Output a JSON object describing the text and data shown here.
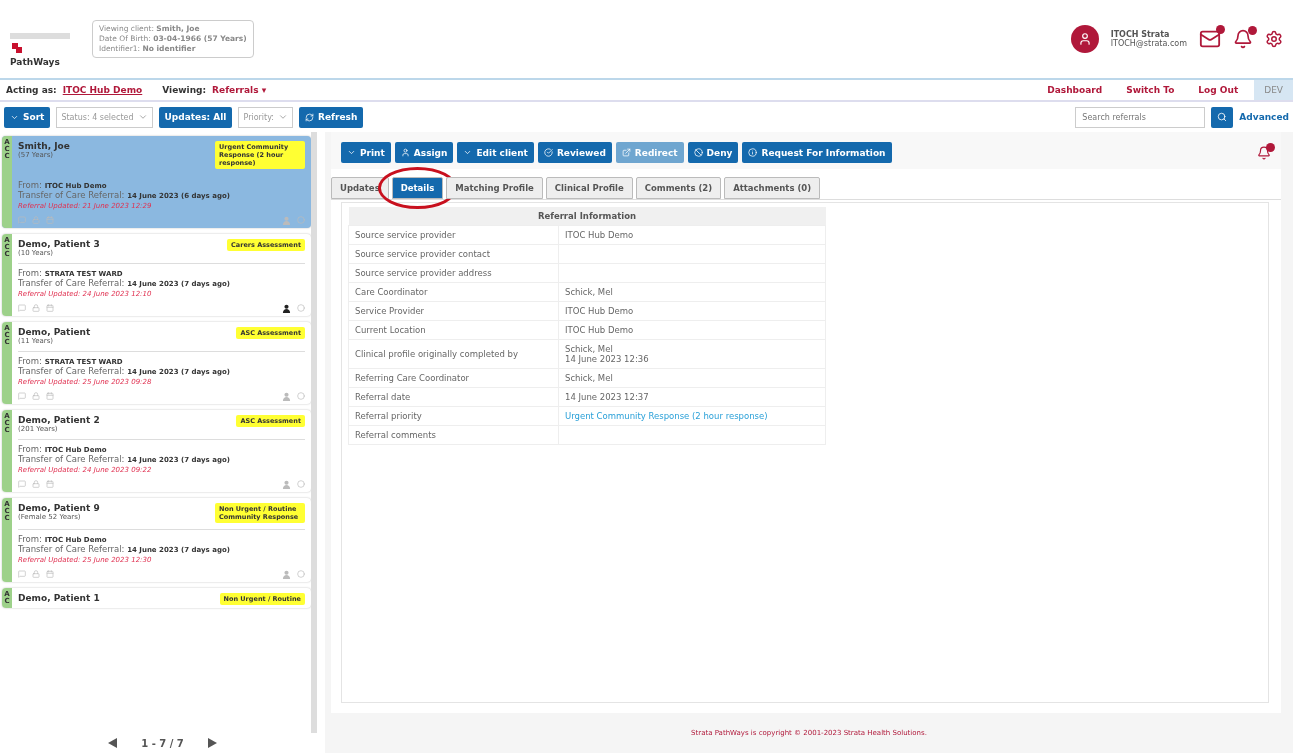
{
  "header": {
    "logo_text": "PathWays",
    "client": {
      "label_name": "Viewing client:",
      "name": "Smith, Joe",
      "label_dob": "Date Of Birth:",
      "dob": "03-04-1966 (57 Years)",
      "label_id": "Identifier1:",
      "identifier": "No identifier"
    },
    "user": {
      "name": "ITOCH Strata",
      "email": "ITOCH@strata.com"
    }
  },
  "nav": {
    "acting_label": "Acting as:",
    "acting_value": "ITOC Hub Demo",
    "viewing_label": "Viewing:",
    "viewing_value": "Referrals",
    "viewing_caret": "▾",
    "links": [
      "Dashboard",
      "Switch To",
      "Log Out"
    ],
    "env": "DEV"
  },
  "toolbar": {
    "sort": "Sort",
    "status": "Status: 4 selected",
    "updates": "Updates: All",
    "priority": "Priority:",
    "refresh": "Refresh",
    "search_placeholder": "Search referrals",
    "advanced": "Advanced"
  },
  "referrals": [
    {
      "strip": [
        "A",
        "C",
        "C"
      ],
      "name": "Smith, Joe",
      "age": "(57 Years)",
      "badge": "Urgent Community Response (2 hour response)",
      "from_label": "From:",
      "from": "ITOC Hub Demo",
      "transfer_label": "Transfer of Care Referral:",
      "transfer": "14 June 2023 (6 days ago)",
      "updated": "Referral Updated: 21 June 2023 12:29",
      "selected": true,
      "assigned": false
    },
    {
      "strip": [
        "A",
        "C",
        "C"
      ],
      "name": "Demo, Patient 3",
      "age": "(10 Years)",
      "badge": "Carers Assessment",
      "from_label": "From:",
      "from": "STRATA TEST WARD",
      "transfer_label": "Transfer of Care Referral:",
      "transfer": "14 June 2023 (7 days ago)",
      "updated": "Referral Updated: 24 June 2023 12:10",
      "selected": false,
      "assigned": true
    },
    {
      "strip": [
        "A",
        "C",
        "C"
      ],
      "name": "Demo, Patient",
      "age": "(11 Years)",
      "badge": "ASC Assessment",
      "from_label": "From:",
      "from": "STRATA TEST WARD",
      "transfer_label": "Transfer of Care Referral:",
      "transfer": "14 June 2023 (7 days ago)",
      "updated": "Referral Updated: 25 June 2023 09:28",
      "selected": false,
      "assigned": false
    },
    {
      "strip": [
        "A",
        "C",
        "C"
      ],
      "name": "Demo, Patient 2",
      "age": "(201 Years)",
      "badge": "ASC Assessment",
      "from_label": "From:",
      "from": "ITOC Hub Demo",
      "transfer_label": "Transfer of Care Referral:",
      "transfer": "14 June 2023 (7 days ago)",
      "updated": "Referral Updated: 24 June 2023 09:22",
      "selected": false,
      "assigned": false
    },
    {
      "strip": [
        "A",
        "C",
        "C"
      ],
      "name": "Demo, Patient 9",
      "age": "(Female 52 Years)",
      "badge": "Non Urgent / Routine Community Response",
      "from_label": "From:",
      "from": "ITOC Hub Demo",
      "transfer_label": "Transfer of Care Referral:",
      "transfer": "14 June 2023 (7 days ago)",
      "updated": "Referral Updated: 25 June 2023 12:30",
      "selected": false,
      "assigned": false
    },
    {
      "strip": [
        "A",
        "C"
      ],
      "name": "Demo, Patient 1",
      "badge": "Non Urgent / Routine",
      "selected": false
    }
  ],
  "pagination": "1 - 7 / 7",
  "actions": [
    {
      "label": "Print",
      "disabled": false
    },
    {
      "label": "Assign",
      "disabled": false
    },
    {
      "label": "Edit client",
      "disabled": false
    },
    {
      "label": "Reviewed",
      "disabled": false
    },
    {
      "label": "Redirect",
      "disabled": true
    },
    {
      "label": "Deny",
      "disabled": false
    },
    {
      "label": "Request For Information",
      "disabled": false
    }
  ],
  "tabs": [
    {
      "label": "Updates",
      "selected": false,
      "circled": false
    },
    {
      "label": "Details",
      "selected": true,
      "circled": true
    },
    {
      "label": "Matching Profile",
      "selected": false,
      "circled": false
    },
    {
      "label": "Clinical Profile",
      "selected": false,
      "circled": false
    },
    {
      "label": "Comments (2)",
      "selected": false,
      "circled": false
    },
    {
      "label": "Attachments (0)",
      "selected": false,
      "circled": false
    }
  ],
  "details": {
    "title": "Referral Information",
    "rows": [
      {
        "label": "Source service provider",
        "value": "ITOC Hub Demo"
      },
      {
        "label": "Source service provider contact"
      },
      {
        "label": "Source service provider address"
      },
      {
        "label": "Care Coordinator",
        "value": "Schick, Mel"
      },
      {
        "label": "Service Provider",
        "value": "ITOC Hub Demo"
      },
      {
        "label": "Current Location",
        "value": "ITOC Hub Demo"
      },
      {
        "label": "Clinical profile originally completed by",
        "value": "Schick, Mel",
        "value2": "14 June 2023 12:36"
      },
      {
        "label": "Referring Care Coordinator",
        "value": "Schick, Mel"
      },
      {
        "label": "Referral date",
        "value": "14 June 2023 12:37"
      },
      {
        "label": "Referral priority",
        "value": "Urgent Community Response (2 hour response)",
        "link": true
      },
      {
        "label": "Referral comments"
      }
    ]
  },
  "footer": "Strata PathWays is copyright © 2001-2023 Strata Health Solutions."
}
